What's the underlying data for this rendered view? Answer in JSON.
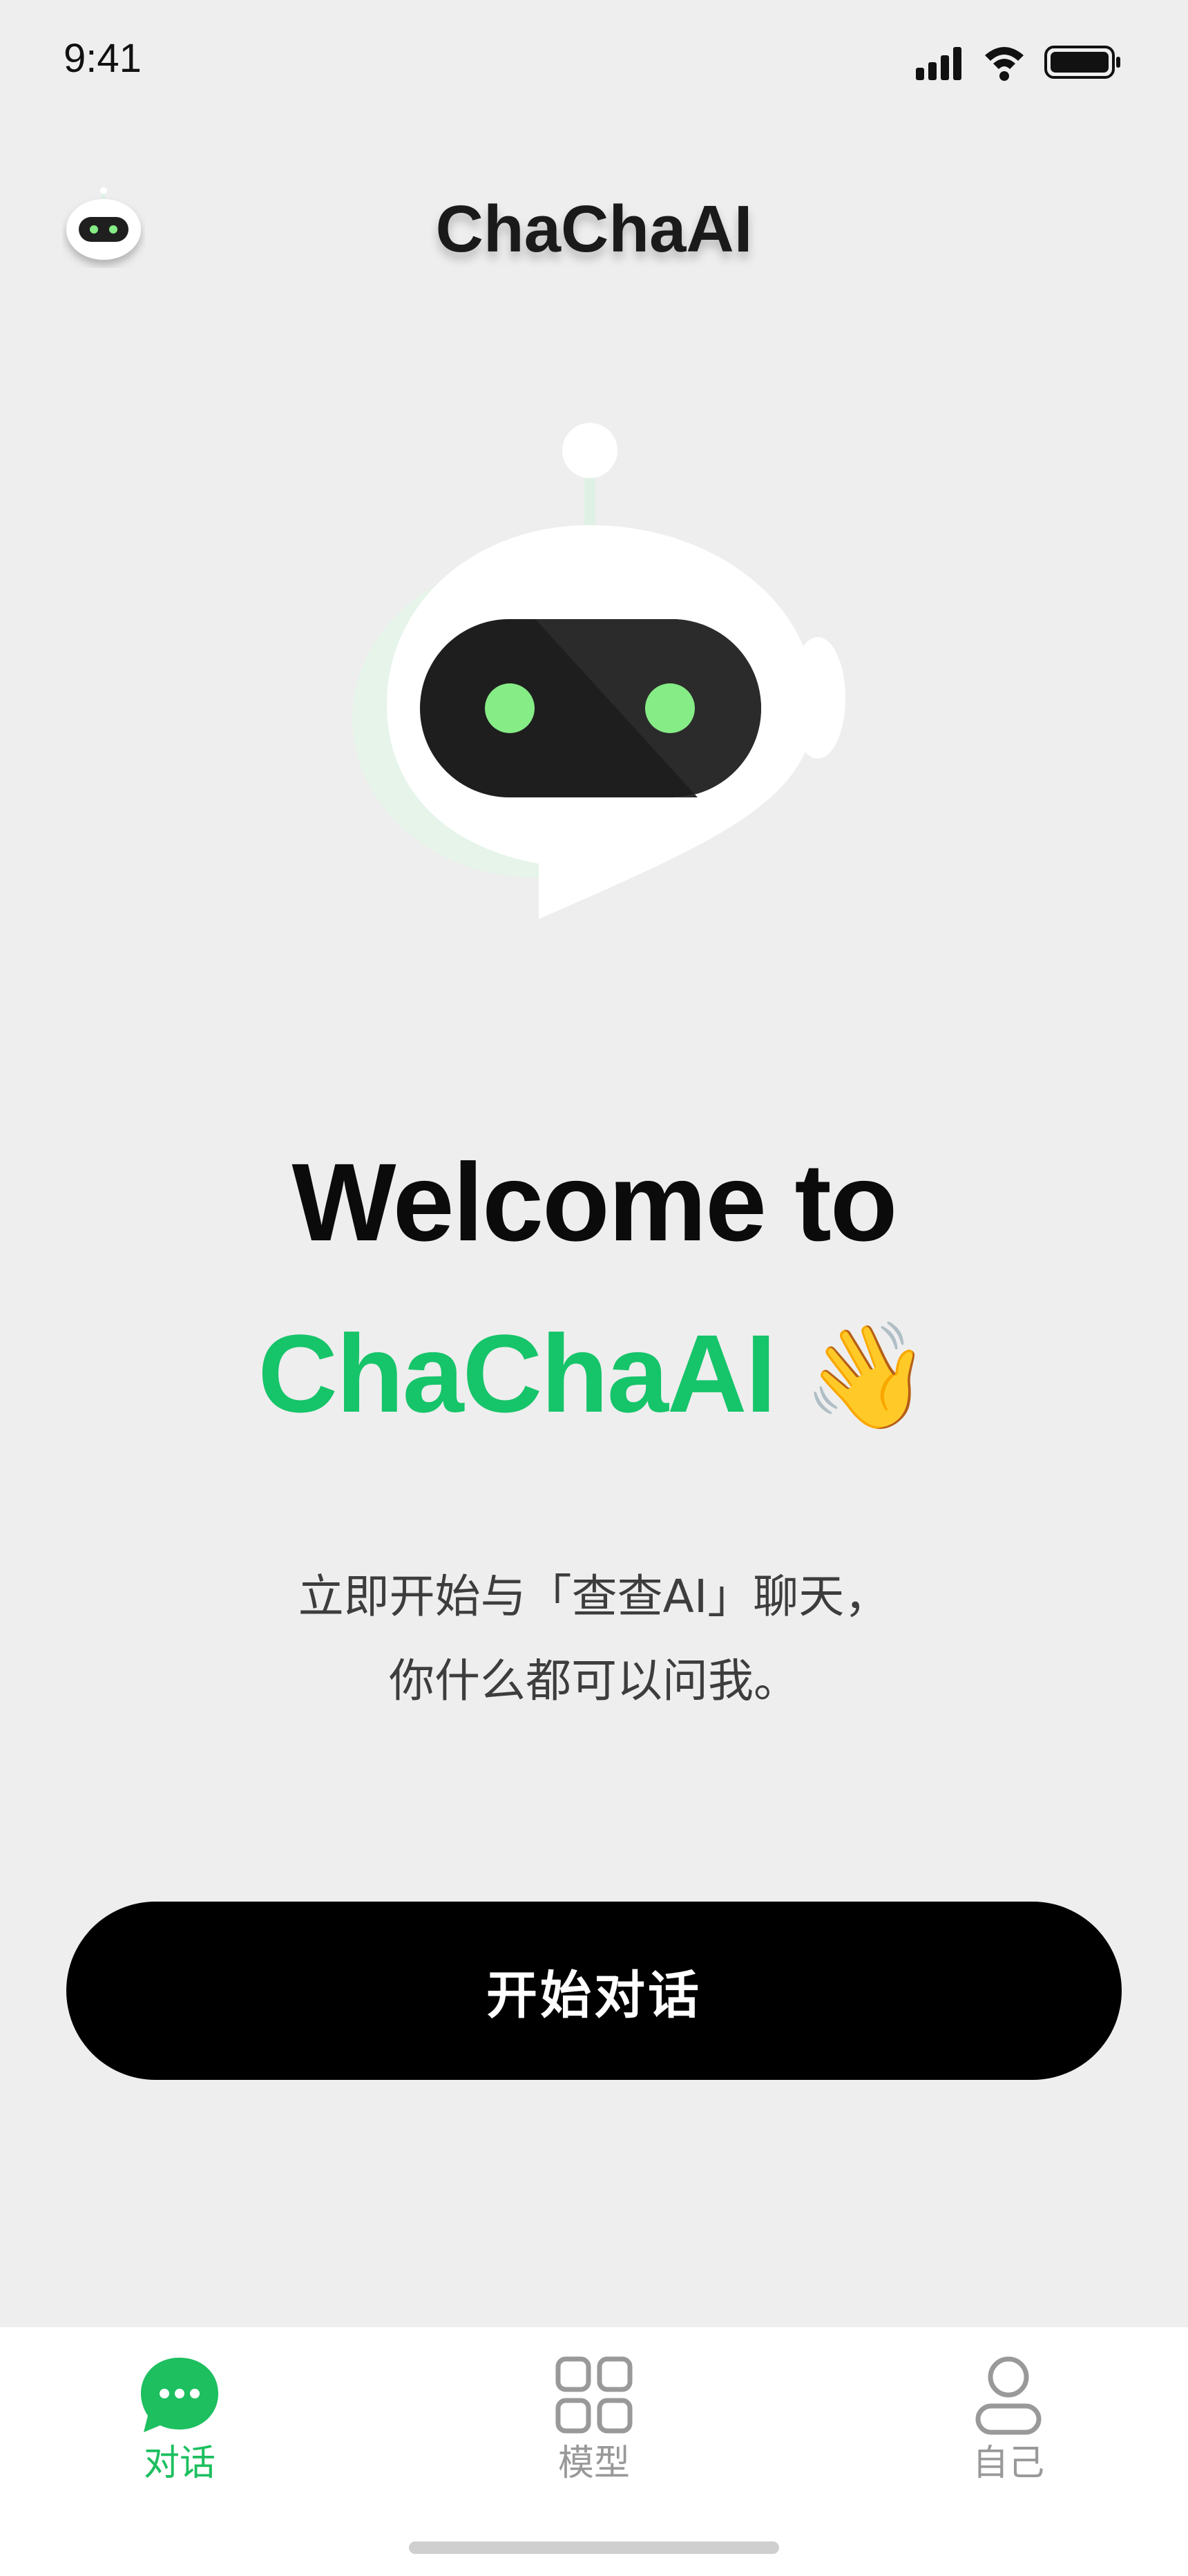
{
  "status_bar": {
    "time": "9:41"
  },
  "header": {
    "title": "ChaChaAI",
    "avatar_icon": "robot-avatar-icon"
  },
  "hero": {
    "icon": "robot-chat-bubble-icon",
    "eye_color": "#86ec86"
  },
  "welcome": {
    "line1": "Welcome to",
    "line2": "ChaChaAI",
    "emoji": "👋",
    "accent_color": "#16c46a"
  },
  "subtitle": {
    "line1": "立即开始与「查查AI」聊天，",
    "line2": "你什么都可以问我。"
  },
  "start_button": {
    "label": "开始对话"
  },
  "tabbar": {
    "active_color": "#1dbf5f",
    "inactive_color": "#999999",
    "tabs": [
      {
        "label": "对话",
        "icon": "chat-bubble-icon",
        "active": true
      },
      {
        "label": "模型",
        "icon": "grid-icon",
        "active": false
      },
      {
        "label": "自己",
        "icon": "user-icon",
        "active": false
      }
    ]
  }
}
